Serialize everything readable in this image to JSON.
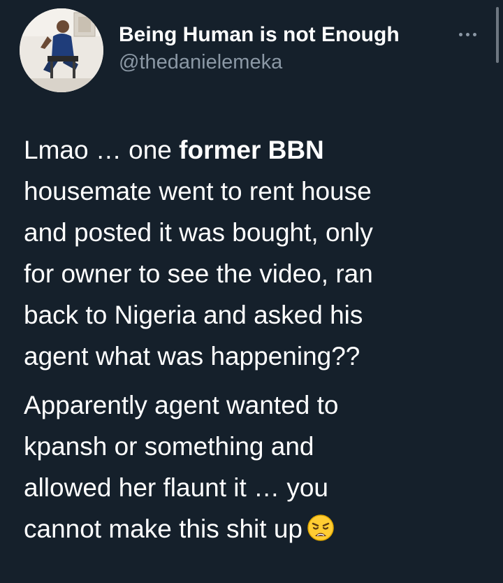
{
  "author": {
    "display_name": "Being Human is not Enough",
    "handle": "@thedanielemeka"
  },
  "more_icon": "more-horizontal-icon",
  "tweet": {
    "p1": {
      "l1_a": "Lmao … one ",
      "l1_b": "former BBN",
      "l2": "housemate went to rent house",
      "l3": "and posted it was bought, only",
      "l4": "for owner to see the video, ran",
      "l5": "back to Nigeria and asked his",
      "l6": "agent what was happening??"
    },
    "p2": {
      "l1": "Apparently agent wanted to",
      "l2": "kpansh or something and",
      "l3": "allowed her flaunt it … you",
      "l4": "cannot make this shit up"
    },
    "emoji": "weary-face-emoji"
  },
  "colors": {
    "background": "#15202b",
    "text": "#ffffff",
    "secondary_text": "#8b98a5"
  }
}
